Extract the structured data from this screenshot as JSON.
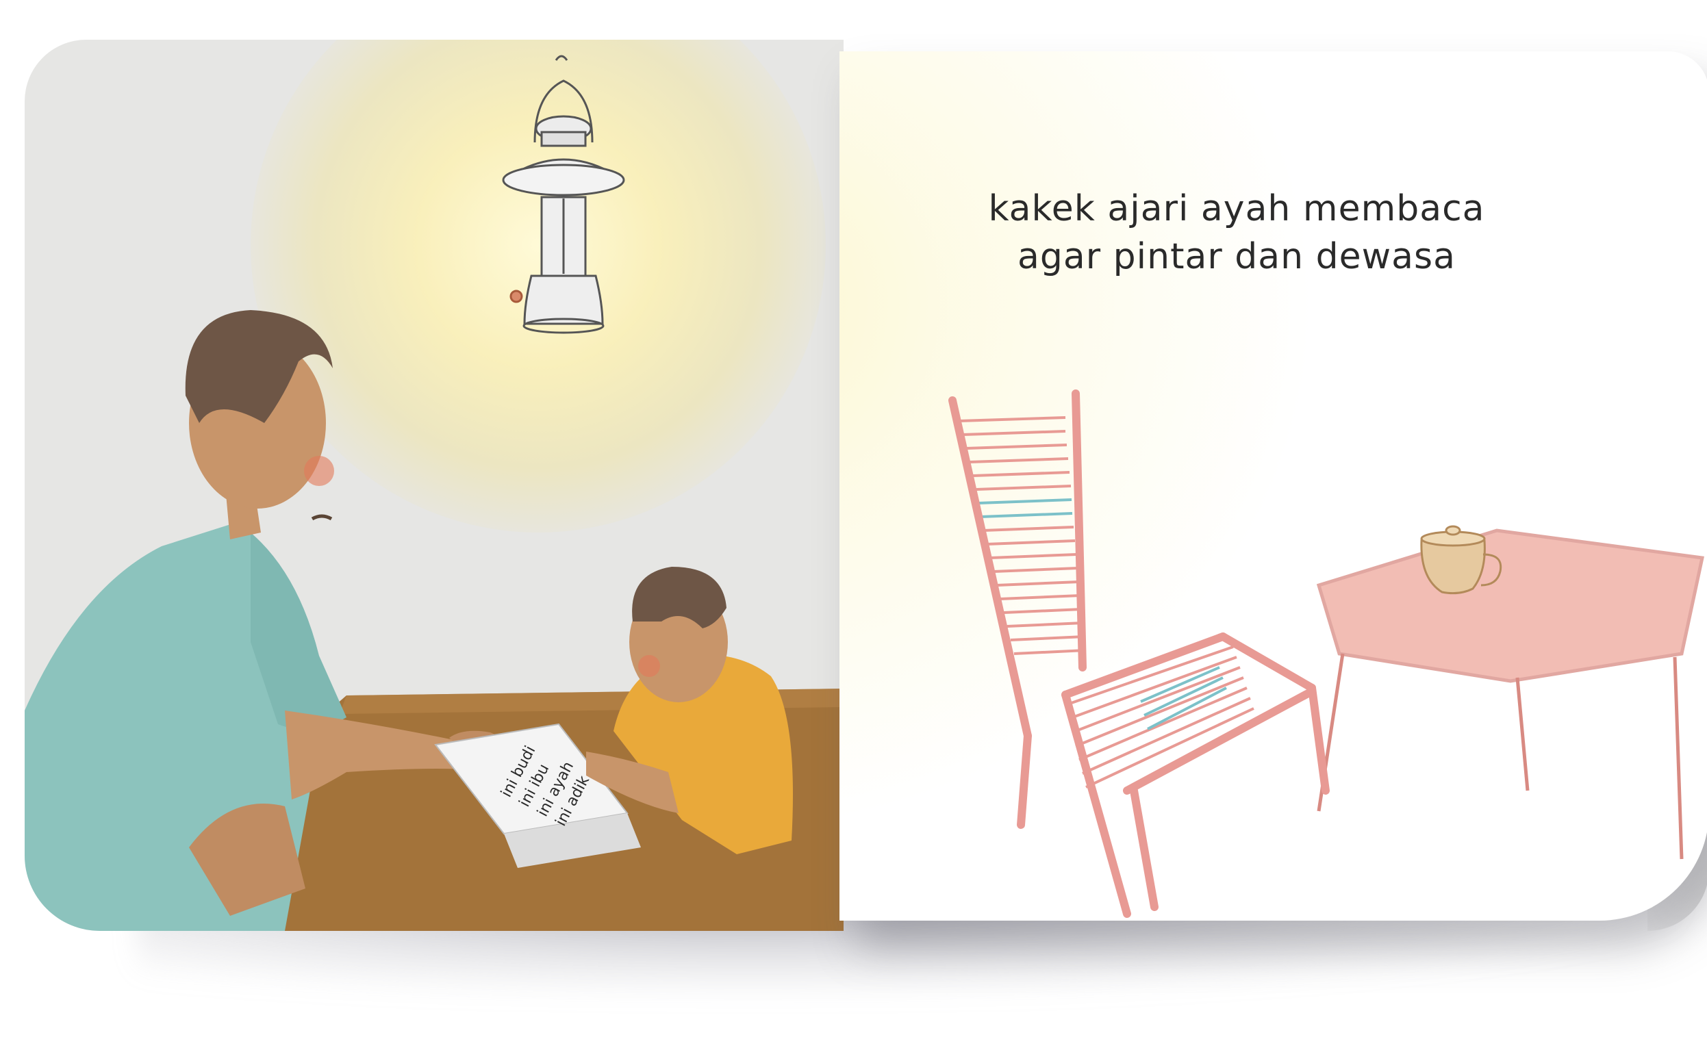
{
  "book": {
    "story_line_1": "kakek ajari ayah membaca",
    "story_line_2": "agar pintar dan dewasa"
  },
  "illustration": {
    "book_text_lines": [
      "ini budi",
      "ini ibu",
      "ini ayah",
      "ini adik"
    ]
  },
  "colors": {
    "wall": "#e6e6e4",
    "glow": "#f6efc4",
    "shirt_man": "#8cc3bd",
    "shirt_boy": "#e9a93a",
    "skin": "#c8956a",
    "hair": "#6e5646",
    "table": "#a3733a",
    "chair": "#e89a94",
    "chair_accent": "#7cc1c9",
    "side_table": "#eea79b"
  }
}
